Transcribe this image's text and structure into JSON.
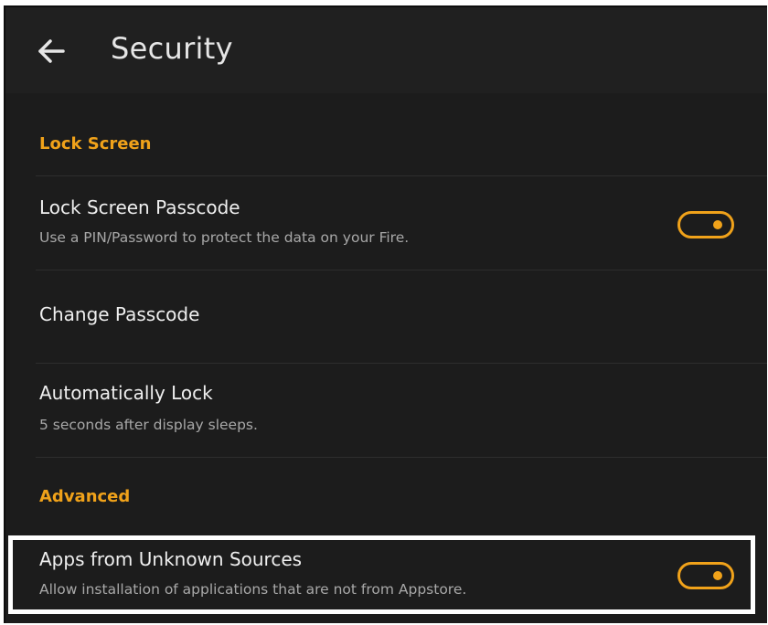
{
  "header": {
    "back_icon": "arrow-left-icon",
    "title": "Security"
  },
  "sections": {
    "lock_screen": {
      "label": "Lock Screen"
    },
    "advanced": {
      "label": "Advanced"
    }
  },
  "items": {
    "lock_screen_passcode": {
      "title": "Lock Screen Passcode",
      "subtitle": "Use a PIN/Password to protect the data on your Fire.",
      "toggle_on": true
    },
    "change_passcode": {
      "title": "Change Passcode"
    },
    "automatically_lock": {
      "title": "Automatically Lock",
      "subtitle": "5 seconds after display sleeps."
    },
    "unknown_sources": {
      "title": "Apps from Unknown Sources",
      "subtitle": "Allow installation of applications that are not from Appstore.",
      "toggle_on": true
    }
  },
  "colors": {
    "background": "#1c1c1c",
    "app_bar": "#202020",
    "accent": "#f0a21a",
    "primary_text": "#efefef",
    "secondary_text": "#a8a8a8",
    "highlight_outline": "#ffffff"
  }
}
